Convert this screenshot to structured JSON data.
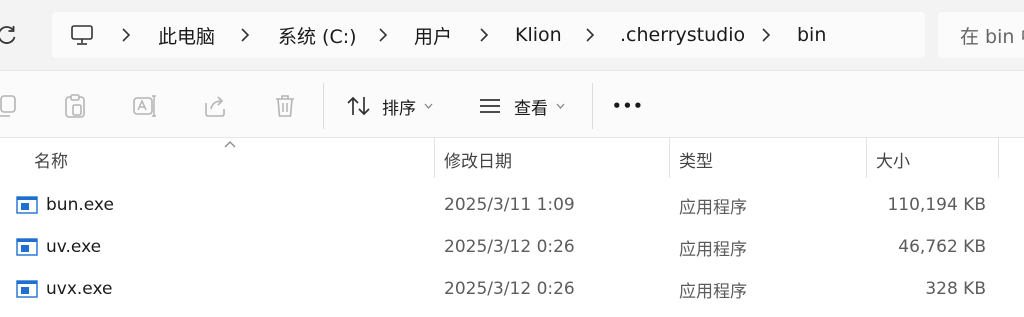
{
  "address_bar": {
    "crumbs": [
      "此电脑",
      "系统 (C:)",
      "用户",
      "Klion",
      ".cherrystudio",
      "bin"
    ]
  },
  "search": {
    "placeholder": "在 bin 中"
  },
  "toolbar": {
    "sort_label": "排序",
    "view_label": "查看",
    "more_label": "•••"
  },
  "columns": {
    "name": "名称",
    "date": "修改日期",
    "type": "类型",
    "size": "大小"
  },
  "files": [
    {
      "name": "bun.exe",
      "date": "2025/3/11 1:09",
      "type": "应用程序",
      "size": "110,194 KB"
    },
    {
      "name": "uv.exe",
      "date": "2025/3/12 0:26",
      "type": "应用程序",
      "size": "46,762 KB"
    },
    {
      "name": "uvx.exe",
      "date": "2025/3/12 0:26",
      "type": "应用程序",
      "size": "328 KB"
    }
  ],
  "icons": {
    "refresh": "refresh-icon",
    "this_pc": "monitor-icon",
    "separator": "chevron-right-icon",
    "file": "exe-file-icon"
  },
  "colors": {
    "file_icon_blue": "#1f6fd1",
    "muted_icon": "#b5b5b5"
  }
}
